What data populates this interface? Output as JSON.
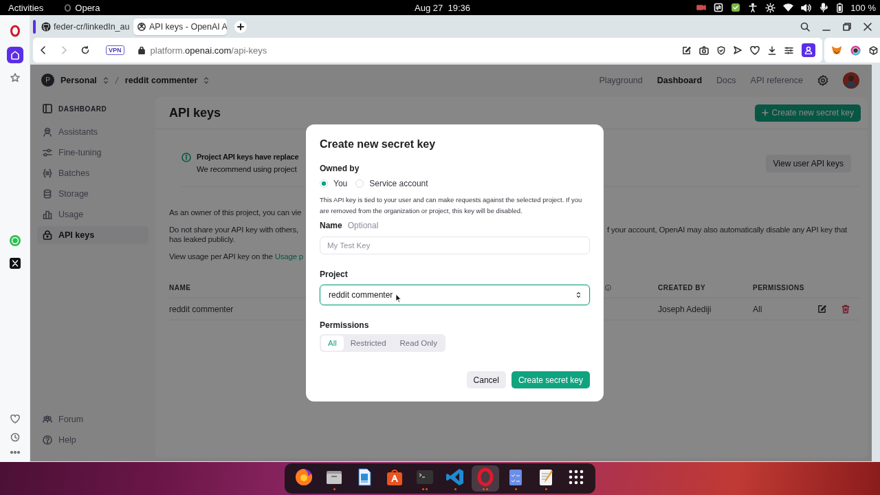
{
  "system_bar": {
    "activities": "Activities",
    "app_name": "Opera",
    "clock": "Aug 27  19:36",
    "battery": "100 %"
  },
  "browser": {
    "tabs": [
      {
        "title": "feder-cr/linkedIn_au",
        "selected": false
      },
      {
        "title": "API keys - OpenAI A",
        "selected": true
      }
    ],
    "vpn_badge": "VPN",
    "address": {
      "subdomain": "platform.",
      "domain": "openai.com",
      "path": "/api-keys"
    }
  },
  "page": {
    "org": {
      "initial": "P",
      "name": "Personal"
    },
    "project": "reddit commenter",
    "nav": [
      {
        "label": "Playground",
        "selected": false
      },
      {
        "label": "Dashboard",
        "selected": true
      },
      {
        "label": "Docs",
        "selected": false
      },
      {
        "label": "API reference",
        "selected": false
      }
    ],
    "sidebar": {
      "heading": "DASHBOARD",
      "items": [
        {
          "label": "Assistants",
          "selected": false
        },
        {
          "label": "Fine-tuning",
          "selected": false
        },
        {
          "label": "Batches",
          "selected": false
        },
        {
          "label": "Storage",
          "selected": false
        },
        {
          "label": "Usage",
          "selected": false
        },
        {
          "label": "API keys",
          "selected": true
        }
      ],
      "footer": [
        {
          "label": "Forum"
        },
        {
          "label": "Help"
        }
      ]
    },
    "title": "API keys",
    "create_button": "Create new secret key",
    "banner": {
      "title": "Project API keys have replace",
      "text": "We recommend using project",
      "button": "View user API keys"
    },
    "paragraphs": [
      {
        "kind": "plain",
        "left": "As an owner of this project, you can vie"
      },
      {
        "kind": "split",
        "left": "Do not share your API key with others,",
        "right": "f your account, OpenAI may also automatically disable any API key that",
        "continuation": "has leaked publicly."
      },
      {
        "kind": "link",
        "left": "View usage per API key on the ",
        "link": "Usage p"
      }
    ],
    "table": {
      "columns": [
        {
          "kind": "text",
          "label": "NAME"
        },
        {
          "kind": "info"
        },
        {
          "kind": "text",
          "label": "CREATED BY"
        },
        {
          "kind": "text",
          "label": "PERMISSIONS"
        }
      ],
      "rows": [
        {
          "name": "reddit commenter",
          "created_by": "Joseph Adediji",
          "permissions": "All"
        }
      ]
    }
  },
  "modal": {
    "title": "Create new secret key",
    "owner_label": "Owned by",
    "owners": [
      {
        "label": "You",
        "selected": true
      },
      {
        "label": "Service account",
        "selected": false
      }
    ],
    "description": "This API key is tied to your user and can make requests against the selected project. If you are removed from the organization or project, this key will be disabled.",
    "name_label": "Name",
    "name_hint": "Optional",
    "name_field": {
      "placeholder": "My Test Key"
    },
    "project_label": "Project",
    "project_select": {
      "value": "reddit commenter",
      "focused": true
    },
    "permissions_label": "Permissions",
    "permissions": [
      {
        "label": "All",
        "selected": true
      },
      {
        "label": "Restricted",
        "selected": false
      },
      {
        "label": "Read Only",
        "selected": false
      }
    ],
    "buttons": [
      {
        "kind": "secondary",
        "label": "Cancel"
      },
      {
        "kind": "primary",
        "label": "Create secret key"
      }
    ]
  },
  "dock": {
    "apps": [
      {
        "kind": "firefox",
        "running": false,
        "multiple": false,
        "focused": false
      },
      {
        "kind": "files",
        "running": true,
        "multiple": false,
        "focused": false
      },
      {
        "kind": "writer",
        "running": false,
        "multiple": false,
        "focused": false
      },
      {
        "kind": "store",
        "running": false,
        "multiple": false,
        "focused": false
      },
      {
        "kind": "terminal",
        "running": true,
        "multiple": true,
        "focused": false
      },
      {
        "kind": "code",
        "running": true,
        "multiple": false,
        "focused": false
      },
      {
        "kind": "opera",
        "running": true,
        "multiple": true,
        "focused": true
      },
      {
        "kind": "tasks",
        "running": true,
        "multiple": false,
        "focused": false
      },
      {
        "kind": "editor",
        "running": true,
        "multiple": false,
        "focused": false
      },
      {
        "kind": "grid",
        "running": false,
        "multiple": false,
        "focused": false
      }
    ]
  }
}
